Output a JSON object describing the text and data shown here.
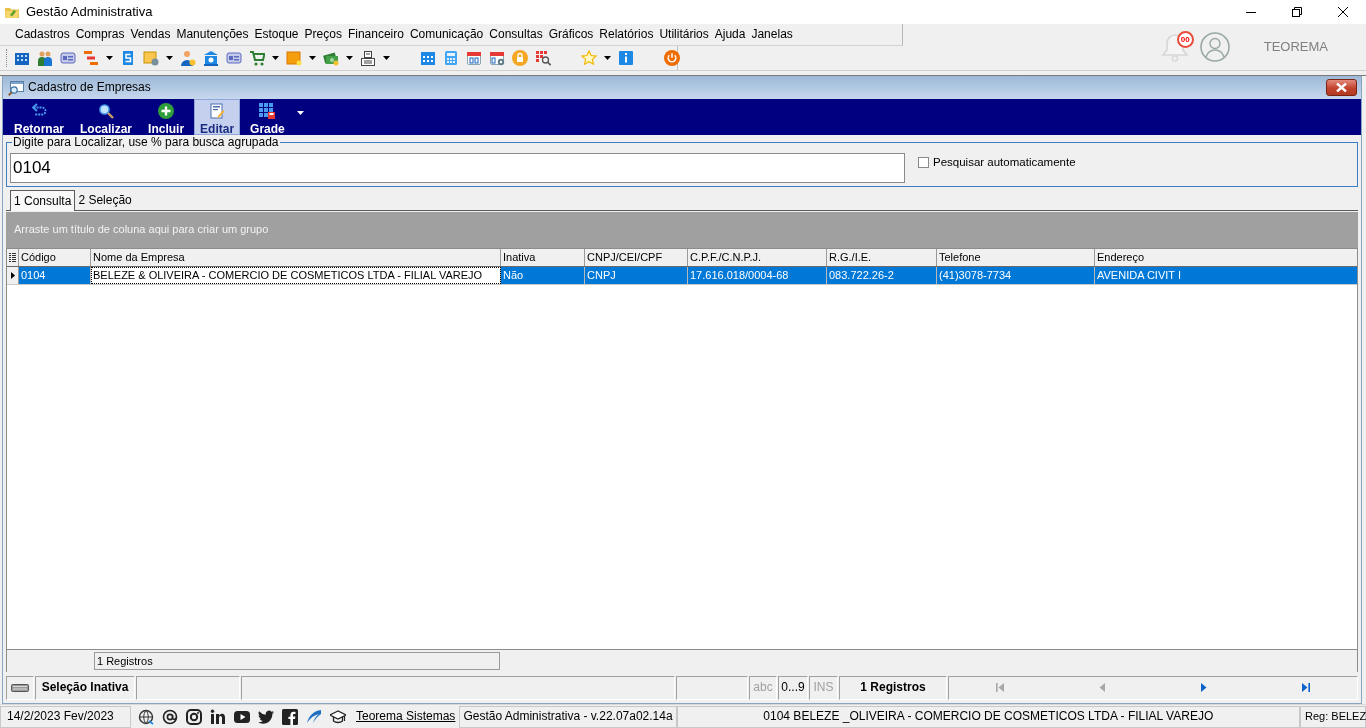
{
  "window": {
    "title": "Gestão Administrativa"
  },
  "menu": [
    "Cadastros",
    "Compras",
    "Vendas",
    "Manutenções",
    "Estoque",
    "Preços",
    "Financeiro",
    "Comunicação",
    "Consultas",
    "Gráficos",
    "Relatórios",
    "Utilitários",
    "Ajuda",
    "Janelas"
  ],
  "notifications": {
    "badge": "00"
  },
  "user": {
    "name": "TEOREMA"
  },
  "form": {
    "title": "Cadastro de Empresas",
    "toolbar": [
      {
        "label": "Retornar",
        "kind": "return",
        "highlighted": false,
        "dropdown": false
      },
      {
        "label": "Localizar",
        "kind": "search",
        "highlighted": false,
        "dropdown": false
      },
      {
        "label": "Incluir",
        "kind": "add",
        "highlighted": false,
        "dropdown": false
      },
      {
        "label": "Editar",
        "kind": "edit",
        "highlighted": true,
        "dropdown": false
      },
      {
        "label": "Grade",
        "kind": "grid",
        "highlighted": false,
        "dropdown": true
      }
    ],
    "search": {
      "label": "Digite para Localizar, use % para busca agrupada",
      "value": "0104"
    },
    "auto_search": {
      "label": "Pesquisar automaticamente",
      "checked": false
    },
    "tabs": [
      {
        "label": "1 Consulta",
        "selected": true
      },
      {
        "label": "2 Seleção",
        "selected": false
      }
    ],
    "group_panel": {
      "hint": "Arraste um título de coluna aqui para criar um grupo"
    },
    "table": {
      "columns": [
        "Código",
        "Nome da Empresa",
        "Inativa",
        "CNPJ/CEI/CPF",
        "C.P.F./C.N.P.J.",
        "R.G./I.E.",
        "Telefone",
        "Endereço"
      ],
      "rows": [
        {
          "selected": true,
          "cells": [
            {
              "text": "0104",
              "focused": false
            },
            {
              "text": "BELEZE & OLIVEIRA - COMERCIO DE COSMETICOS LTDA - FILIAL VAREJO",
              "focused": true
            },
            {
              "text": "Não",
              "focused": false
            },
            {
              "text": "CNPJ",
              "focused": false
            },
            {
              "text": "17.616.018/0004-68",
              "focused": false
            },
            {
              "text": "083.722.26-2",
              "focused": false
            },
            {
              "text": "(41)3078-7734",
              "focused": false
            },
            {
              "text": "AVENIDA CIVIT I",
              "focused": false
            }
          ]
        }
      ]
    },
    "footer": {
      "count": "1 Registros"
    },
    "status_bar": {
      "selection": "Seleção Inativa",
      "indicators": [
        {
          "label": "abc",
          "disabled": true
        },
        {
          "label": "0...9",
          "disabled": false
        },
        {
          "label": "INS",
          "disabled": true
        }
      ],
      "count": "1 Registros",
      "navigation": [
        {
          "kind": "first",
          "disabled": true
        },
        {
          "kind": "prev",
          "disabled": true
        },
        {
          "kind": "next",
          "disabled": false
        },
        {
          "kind": "last",
          "disabled": false
        }
      ]
    }
  },
  "bottom_bar": {
    "date": "14/2/2023 Fev/2023",
    "link": "Teorema Sistemas",
    "version": "Gestão Administrativa - v.22.07a02.14a",
    "company": "0104 BELEZE _OLIVEIRA - COMERCIO DE COSMETICOS LTDA - FILIAL VAREJO",
    "registration": "Reg: BELEZ"
  }
}
